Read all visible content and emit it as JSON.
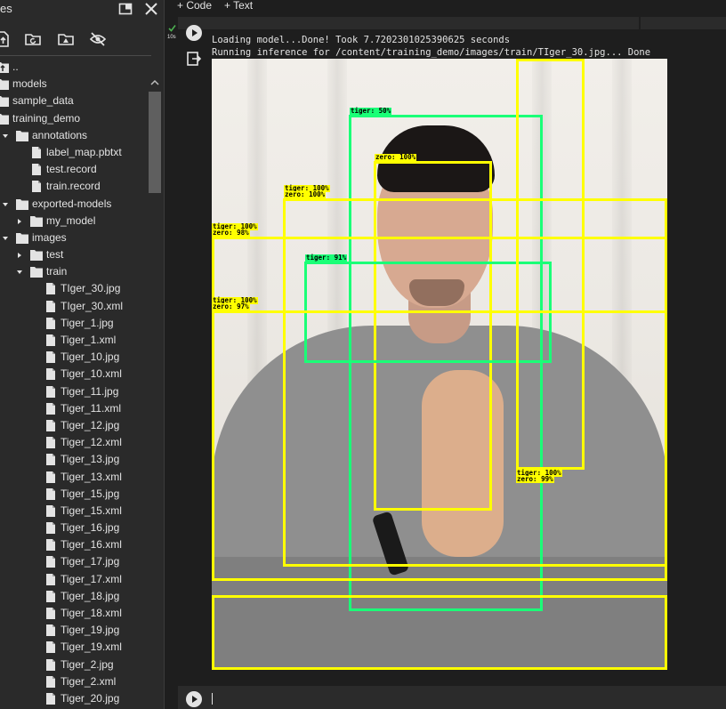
{
  "file_panel": {
    "title": "es",
    "items": [
      {
        "label": "..",
        "icon": "folder-up-icon",
        "indent": 0,
        "chevron": "none"
      },
      {
        "label": "models",
        "icon": "folder-icon",
        "indent": 0,
        "chevron": "none"
      },
      {
        "label": "sample_data",
        "icon": "folder-icon",
        "indent": 0,
        "chevron": "none"
      },
      {
        "label": "training_demo",
        "icon": "folder-icon",
        "indent": 0,
        "chevron": "none"
      },
      {
        "label": "annotations",
        "icon": "folder-icon",
        "indent": 1,
        "chevron": "down"
      },
      {
        "label": "label_map.pbtxt",
        "icon": "file-icon",
        "indent": 2,
        "chevron": "none"
      },
      {
        "label": "test.record",
        "icon": "file-icon",
        "indent": 2,
        "chevron": "none"
      },
      {
        "label": "train.record",
        "icon": "file-icon",
        "indent": 2,
        "chevron": "none"
      },
      {
        "label": "exported-models",
        "icon": "folder-icon",
        "indent": 1,
        "chevron": "down"
      },
      {
        "label": "my_model",
        "icon": "folder-icon",
        "indent": 2,
        "chevron": "right"
      },
      {
        "label": "images",
        "icon": "folder-icon",
        "indent": 1,
        "chevron": "down"
      },
      {
        "label": "test",
        "icon": "folder-icon",
        "indent": 2,
        "chevron": "right"
      },
      {
        "label": "train",
        "icon": "folder-icon",
        "indent": 2,
        "chevron": "down"
      },
      {
        "label": "TIger_30.jpg",
        "icon": "file-icon",
        "indent": 3,
        "chevron": "none"
      },
      {
        "label": "TIger_30.xml",
        "icon": "file-icon",
        "indent": 3,
        "chevron": "none"
      },
      {
        "label": "Tiger_1.jpg",
        "icon": "file-icon",
        "indent": 3,
        "chevron": "none"
      },
      {
        "label": "Tiger_1.xml",
        "icon": "file-icon",
        "indent": 3,
        "chevron": "none"
      },
      {
        "label": "Tiger_10.jpg",
        "icon": "file-icon",
        "indent": 3,
        "chevron": "none"
      },
      {
        "label": "Tiger_10.xml",
        "icon": "file-icon",
        "indent": 3,
        "chevron": "none"
      },
      {
        "label": "Tiger_11.jpg",
        "icon": "file-icon",
        "indent": 3,
        "chevron": "none"
      },
      {
        "label": "Tiger_11.xml",
        "icon": "file-icon",
        "indent": 3,
        "chevron": "none"
      },
      {
        "label": "Tiger_12.jpg",
        "icon": "file-icon",
        "indent": 3,
        "chevron": "none"
      },
      {
        "label": "Tiger_12.xml",
        "icon": "file-icon",
        "indent": 3,
        "chevron": "none"
      },
      {
        "label": "Tiger_13.jpg",
        "icon": "file-icon",
        "indent": 3,
        "chevron": "none"
      },
      {
        "label": "Tiger_13.xml",
        "icon": "file-icon",
        "indent": 3,
        "chevron": "none"
      },
      {
        "label": "Tiger_15.jpg",
        "icon": "file-icon",
        "indent": 3,
        "chevron": "none"
      },
      {
        "label": "Tiger_15.xml",
        "icon": "file-icon",
        "indent": 3,
        "chevron": "none"
      },
      {
        "label": "Tiger_16.jpg",
        "icon": "file-icon",
        "indent": 3,
        "chevron": "none"
      },
      {
        "label": "Tiger_16.xml",
        "icon": "file-icon",
        "indent": 3,
        "chevron": "none"
      },
      {
        "label": "Tiger_17.jpg",
        "icon": "file-icon",
        "indent": 3,
        "chevron": "none"
      },
      {
        "label": "Tiger_17.xml",
        "icon": "file-icon",
        "indent": 3,
        "chevron": "none"
      },
      {
        "label": "Tiger_18.jpg",
        "icon": "file-icon",
        "indent": 3,
        "chevron": "none"
      },
      {
        "label": "Tiger_18.xml",
        "icon": "file-icon",
        "indent": 3,
        "chevron": "none"
      },
      {
        "label": "Tiger_19.jpg",
        "icon": "file-icon",
        "indent": 3,
        "chevron": "none"
      },
      {
        "label": "Tiger_19.xml",
        "icon": "file-icon",
        "indent": 3,
        "chevron": "none"
      },
      {
        "label": "Tiger_2.jpg",
        "icon": "file-icon",
        "indent": 3,
        "chevron": "none"
      },
      {
        "label": "Tiger_2.xml",
        "icon": "file-icon",
        "indent": 3,
        "chevron": "none"
      },
      {
        "label": "Tiger_20.jpg",
        "icon": "file-icon",
        "indent": 3,
        "chevron": "none"
      }
    ]
  },
  "toolbar": {
    "code_label": "+ Code",
    "text_label": "+ Text"
  },
  "cell": {
    "exec_time": "10s",
    "output_lines": [
      "Loading model...Done! Took 7.7202301025390625 seconds",
      "Running inference for /content/training_demo/images/train/TIger_30.jpg... Done"
    ]
  },
  "detections": [
    {
      "labels": [
        "tiger: 50%"
      ],
      "color": "green"
    },
    {
      "labels": [
        "zero: 100%"
      ],
      "color": "yellow"
    },
    {
      "labels": [
        "tiger: 100%",
        "zero: 100%"
      ],
      "color": "yellow"
    },
    {
      "labels": [
        "tiger: 100%",
        "zero: 98%"
      ],
      "color": "yellow"
    },
    {
      "labels": [
        "tiger: 91%"
      ],
      "color": "green"
    },
    {
      "labels": [
        "tiger: 100%",
        "zero: 97%"
      ],
      "color": "yellow"
    },
    {
      "labels": [
        "tiger: 100%",
        "zero: 99%"
      ],
      "color": "yellow"
    },
    {
      "labels": [],
      "color": "yellow"
    },
    {
      "labels": [],
      "color": "yellow"
    }
  ],
  "colors": {
    "yellow_box": "#ffff00",
    "green_box": "#1aff77",
    "background": "#1e1e1e",
    "panel": "#2a2a2a"
  }
}
